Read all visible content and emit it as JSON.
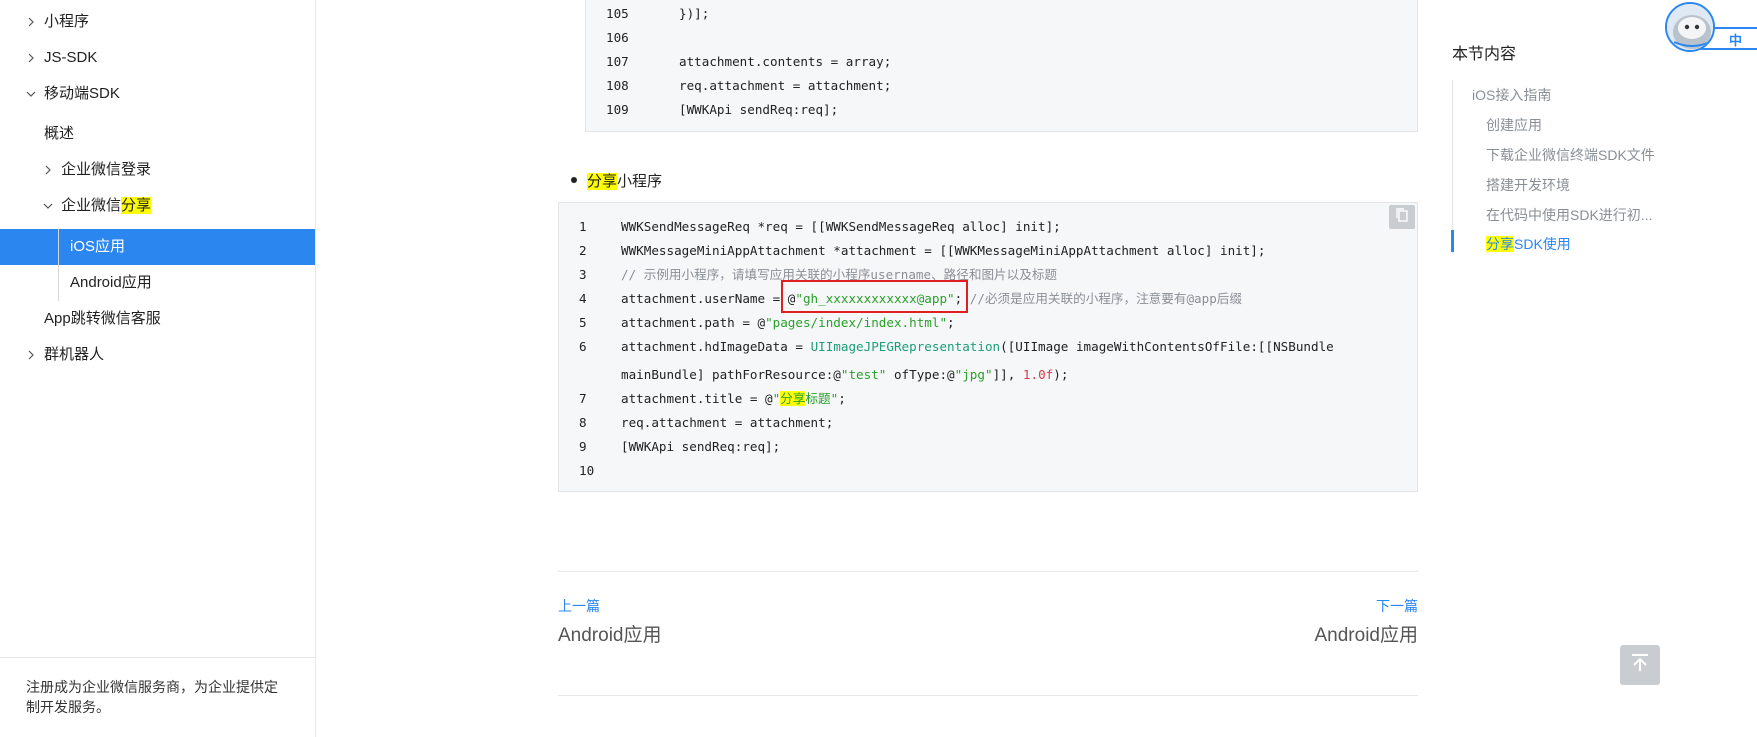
{
  "sidebar": {
    "items": [
      {
        "label": "小程序",
        "expanded": false
      },
      {
        "label": "JS-SDK",
        "expanded": false
      },
      {
        "label": "移动端SDK",
        "expanded": true
      },
      {
        "label": "概述"
      },
      {
        "label": "企业微信登录",
        "expanded": false
      },
      {
        "label_pre": "企业微信",
        "label_hl": "分享",
        "expanded": true
      },
      {
        "label": "iOS应用",
        "active": true
      },
      {
        "label": "Android应用"
      },
      {
        "label": "App跳转微信客服"
      },
      {
        "label": "群机器人",
        "expanded": false
      }
    ],
    "footer_line1": "注册成为企业微信服务商，为企业提供定",
    "footer_line2": "制开发服务。"
  },
  "code_top": {
    "lines": [
      {
        "n": "105",
        "text": "})];"
      },
      {
        "n": "106",
        "text": ""
      },
      {
        "n": "107",
        "text": "attachment.contents = array;"
      },
      {
        "n": "108",
        "text": "req.attachment = attachment;"
      },
      {
        "n": "109",
        "text": "[WWKApi sendReq:req];"
      }
    ]
  },
  "bullet": {
    "hl": "分享",
    "rest": "小程序"
  },
  "code_main": {
    "nums": [
      "1",
      "2",
      "3",
      "4",
      "5",
      "6",
      "7",
      "8",
      "9",
      "10"
    ],
    "l1": "WWKSendMessageReq *req = [[WWKSendMessageReq alloc] init];",
    "l2": "WWKMessageMiniAppAttachment *attachment = [[WWKMessageMiniAppAttachment alloc] init];",
    "l3": "// 示例用小程序，请填写应用关联的小程序username、路径和图片以及标题",
    "l4_a": "attachment.userName = @",
    "l4_str": "\"gh_xxxxxxxxxxxx@app\"",
    "l4_b": "; ",
    "l4_cmt": "//必须是应用关联的小程序，注意要有@app后缀",
    "l5_a": "attachment.path = @",
    "l5_str": "\"pages/index/index.html\"",
    "l5_b": ";",
    "l6_a": "attachment.hdImageData = ",
    "l6_fn": "UIImageJPEGRepresentation",
    "l6_b": "([UIImage imageWithContentsOfFile:[[NSBundle",
    "l6c_a": "mainBundle] pathForResource:@",
    "l6c_str1": "\"test\"",
    "l6c_b": " ofType:@",
    "l6c_str2": "\"jpg\"",
    "l6c_c": "]], ",
    "l6c_num": "1.0f",
    "l6c_d": ");",
    "l7_a": "attachment.title = @",
    "l7_q1": "\"",
    "l7_hl": "分享",
    "l7_str": "标题\"",
    "l7_b": ";",
    "l8": "req.attachment = attachment;",
    "l9": "[WWKApi sendReq:req];"
  },
  "pager": {
    "prev_label": "上一篇",
    "prev_title": "Android应用",
    "next_label": "下一篇",
    "next_title": "Android应用"
  },
  "toc": {
    "title": "本节内容",
    "items": [
      "iOS接入指南",
      "创建应用",
      "下载企业微信终端SDK文件",
      "搭建开发环境",
      "在代码中使用SDK进行初..."
    ],
    "active_hl": "分享",
    "active_rest": "SDK使用"
  },
  "lang_widget": {
    "label": "中"
  },
  "colors": {
    "accent": "#2b86f0",
    "highlight": "#ffff00",
    "annotation": "#e02020"
  }
}
